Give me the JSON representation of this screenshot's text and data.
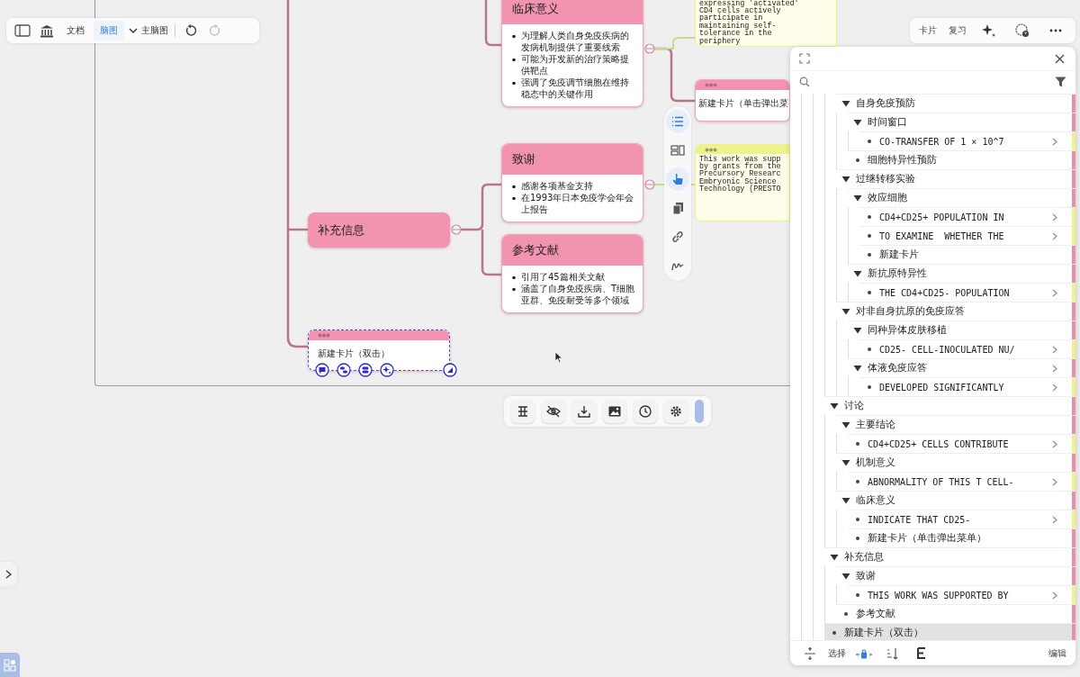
{
  "toolbar": {
    "tabs": [
      {
        "label": "文档",
        "selected": false
      },
      {
        "label": "脑图",
        "selected": true
      }
    ],
    "map_selector": "主脑图",
    "undo_disabled": false,
    "redo_disabled": true
  },
  "right_toolbar": {
    "buttons": [
      "卡片",
      "复习"
    ]
  },
  "side_tools": [
    {
      "kind": "list",
      "active": true
    },
    {
      "kind": "layout",
      "active": false
    },
    {
      "kind": "pointer",
      "active": true
    },
    {
      "kind": "copy",
      "active": false
    },
    {
      "kind": "link",
      "active": false
    },
    {
      "kind": "draw",
      "active": false
    }
  ],
  "nodes": [
    {
      "kind": "topic_card",
      "title": "临床意义",
      "color": "#f293b0",
      "selected": false,
      "bullets": [
        "为理解人类自身免疫疾病的发病机制提供了重要线索",
        "可能为开发新的治疗策略提供靶点",
        "强调了免疫调节细胞在维持稳态中的关键作用"
      ]
    },
    {
      "kind": "topic_card",
      "title": "致谢",
      "color": "#f293b0",
      "selected": false,
      "bullets": [
        "感谢各项基金支持",
        "在1993年日本免疫学会年会上报告"
      ]
    },
    {
      "kind": "topic_card",
      "title": "参考文献",
      "color": "#f293b0",
      "selected": false,
      "bullets": [
        "引用了45篇相关文献",
        "涵盖了自身免疫疾病、T细胞亚群、免疫耐受等多个领域"
      ]
    },
    {
      "kind": "topic",
      "title": "补充信息",
      "color": "#f293b0",
      "selected": false
    },
    {
      "kind": "new_card",
      "text": "新建卡片（双击）",
      "color": "#f293b0",
      "selected": true
    },
    {
      "kind": "excerpt",
      "color": "#eef28a",
      "selected": false,
      "lines": [
        "expressing 'activated'",
        "CD4 cells actively",
        "participate in",
        "maintaining self-",
        "tolerance in the",
        "periphery"
      ]
    },
    {
      "kind": "new_card",
      "text": "新建卡片（单击弹出菜",
      "color": "#f293b0",
      "selected": false
    },
    {
      "kind": "excerpt",
      "color": "#eef28a",
      "selected": false,
      "lines": [
        "This work was supp",
        "by grants from the",
        "Precursory Researc",
        "Embryonic Science",
        "Technology (PRESTO"
      ]
    }
  ],
  "outline": {
    "tree": [
      {
        "children": [
          {
            "label": "自身免疫预防",
            "kind": "group",
            "expanded": true,
            "has_detail": false,
            "selected": false,
            "color": "#e98fab",
            "children": [
              {
                "label": "时间窗口",
                "kind": "group",
                "expanded": true,
                "has_detail": false,
                "selected": false,
                "color": "#e98fab",
                "children": [
                  {
                    "label": "CO-TRANSFER OF 1 × 10^7",
                    "kind": "excerpt",
                    "has_detail": true,
                    "selected": false,
                    "color": "#eef28a"
                  }
                ]
              },
              {
                "label": "细胞特异性预防",
                "kind": "card",
                "has_detail": false,
                "selected": false,
                "color": "#e98fab"
              }
            ]
          },
          {
            "label": "过继转移实验",
            "kind": "group",
            "expanded": true,
            "has_detail": false,
            "selected": false,
            "color": "#e98fab",
            "children": [
              {
                "label": "效应细胞",
                "kind": "group",
                "expanded": true,
                "has_detail": false,
                "selected": false,
                "color": "#e98fab",
                "children": [
                  {
                    "label": "CD4+CD25+ POPULATION IN",
                    "kind": "excerpt",
                    "has_detail": true,
                    "selected": false,
                    "color": "#eef28a"
                  },
                  {
                    "label": "TO EXAMINE  WHETHER THE",
                    "kind": "excerpt",
                    "has_detail": true,
                    "selected": false,
                    "color": "#eef28a"
                  },
                  {
                    "label": "新建卡片",
                    "kind": "card",
                    "has_detail": false,
                    "selected": false,
                    "color": "#e98fab"
                  }
                ]
              },
              {
                "label": "新抗原特异性",
                "kind": "group",
                "expanded": true,
                "has_detail": false,
                "selected": false,
                "color": "#e98fab",
                "children": [
                  {
                    "label": "THE CD4+CD25- POPULATION",
                    "kind": "excerpt",
                    "has_detail": true,
                    "selected": false,
                    "color": "#eef28a"
                  }
                ]
              }
            ]
          },
          {
            "label": "对非自身抗原的免疫应答",
            "kind": "group",
            "expanded": true,
            "has_detail": false,
            "selected": false,
            "color": "#e98fab",
            "children": [
              {
                "label": "同种异体皮肤移植",
                "kind": "group",
                "expanded": true,
                "has_detail": false,
                "selected": false,
                "color": "#e98fab",
                "children": [
                  {
                    "label": "CD25- CELL-INOCULATED NU/",
                    "kind": "excerpt",
                    "has_detail": true,
                    "selected": false,
                    "color": "#eef28a"
                  }
                ]
              },
              {
                "label": "体液免疫应答",
                "kind": "group",
                "expanded": true,
                "has_detail": true,
                "selected": false,
                "color": "#e98fab",
                "children": [
                  {
                    "label": "DEVELOPED SIGNIFICANTLY",
                    "kind": "excerpt",
                    "has_detail": true,
                    "selected": false,
                    "color": "#eef28a"
                  }
                ]
              }
            ]
          }
        ]
      },
      {
        "label": "讨论",
        "kind": "group",
        "expanded": true,
        "has_detail": false,
        "selected": false,
        "color": "#e98fab",
        "children": [
          {
            "label": "主要结论",
            "kind": "group",
            "expanded": true,
            "has_detail": false,
            "selected": false,
            "color": "#e98fab",
            "children": [
              {
                "label": "CD4+CD25+ CELLS CONTRIBUTE",
                "kind": "excerpt",
                "has_detail": true,
                "selected": false,
                "color": "#eef28a"
              }
            ]
          },
          {
            "label": "机制意义",
            "kind": "group",
            "expanded": true,
            "has_detail": false,
            "selected": false,
            "color": "#e98fab",
            "children": [
              {
                "label": "ABNORMALITY OF THIS T CELL-",
                "kind": "excerpt",
                "has_detail": true,
                "selected": false,
                "color": "#eef28a"
              }
            ]
          },
          {
            "label": "临床意义",
            "kind": "group",
            "expanded": true,
            "has_detail": false,
            "selected": false,
            "color": "#e98fab",
            "children": [
              {
                "label": "INDICATE THAT CD25-",
                "kind": "excerpt",
                "has_detail": true,
                "selected": false,
                "color": "#eef28a"
              },
              {
                "label": "新建卡片（单击弹出菜单）",
                "kind": "card",
                "has_detail": false,
                "selected": false,
                "color": "#e98fab"
              }
            ]
          }
        ]
      },
      {
        "label": "补充信息",
        "kind": "group",
        "expanded": true,
        "has_detail": false,
        "selected": false,
        "color": "#e98fab",
        "children": [
          {
            "label": "致谢",
            "kind": "group",
            "expanded": true,
            "has_detail": false,
            "selected": false,
            "color": "#e98fab",
            "children": [
              {
                "label": "THIS WORK WAS SUPPORTED BY",
                "kind": "excerpt",
                "has_detail": true,
                "selected": false,
                "color": "#eef28a"
              }
            ]
          },
          {
            "label": "参考文献",
            "kind": "card",
            "has_detail": false,
            "selected": false,
            "color": "#e98fab"
          }
        ]
      },
      {
        "label": "新建卡片（双击）",
        "kind": "card",
        "has_detail": false,
        "selected": true,
        "color": "#e98fab"
      }
    ],
    "footer": {
      "select": "选择",
      "edit": "编辑"
    }
  }
}
